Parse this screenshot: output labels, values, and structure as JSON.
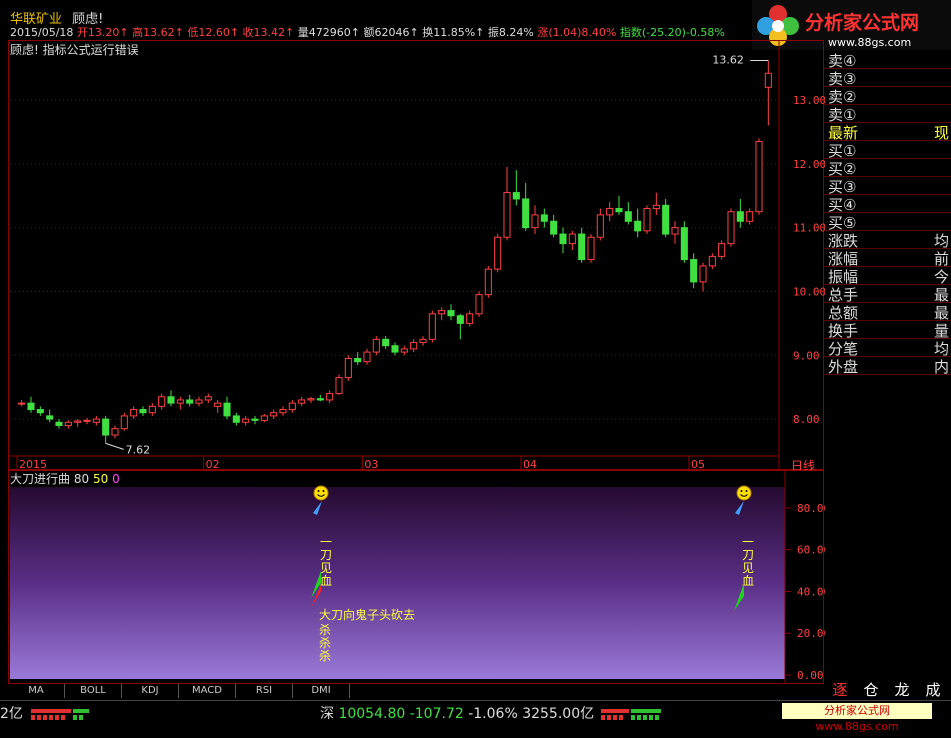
{
  "header": {
    "stock_name": "华联矿业",
    "warning": "顾虑!",
    "date": "2015/05/18",
    "quotes": [
      {
        "label": "开",
        "value": "13.20",
        "color": "red"
      },
      {
        "label": "高",
        "value": "13.62",
        "color": "red"
      },
      {
        "label": "低",
        "value": "12.60",
        "color": "red"
      },
      {
        "label": "收",
        "value": "13.42",
        "color": "red"
      },
      {
        "label": "量",
        "value": "472960",
        "color": "white"
      },
      {
        "label": "额",
        "value": "62046",
        "color": "white"
      },
      {
        "label": "换",
        "value": "11.85%",
        "color": "white"
      },
      {
        "label": "振",
        "value": "8.24%",
        "color": "white"
      },
      {
        "label": "涨",
        "value": "(1.04)8.40%",
        "color": "red"
      },
      {
        "label": "指数",
        "value": "(-25.20)-0.58%",
        "color": "green"
      }
    ],
    "error_message": "顾虑! 指标公式运行错误"
  },
  "logo": {
    "title": "分析家公式网",
    "url": "www.88gs.com"
  },
  "main_chart": {
    "price_labels": [
      "13.00",
      "12.00",
      "11.00",
      "10.00",
      "9.00",
      "8.00"
    ],
    "high_marker": "13.62",
    "low_marker": "7.62",
    "x_labels": [
      "2015",
      "02",
      "03",
      "04",
      "05"
    ],
    "period": "日线"
  },
  "right_panel": [
    {
      "label": "卖④",
      "value": ""
    },
    {
      "label": "卖③",
      "value": ""
    },
    {
      "label": "卖②",
      "value": ""
    },
    {
      "label": "卖①",
      "value": ""
    },
    {
      "label": "最新",
      "value": "现",
      "highlight": true
    },
    {
      "label": "买①",
      "value": ""
    },
    {
      "label": "买②",
      "value": ""
    },
    {
      "label": "买③",
      "value": ""
    },
    {
      "label": "买④",
      "value": ""
    },
    {
      "label": "买⑤",
      "value": ""
    },
    {
      "label": "涨跌",
      "value": "均"
    },
    {
      "label": "涨幅",
      "value": "前"
    },
    {
      "label": "振幅",
      "value": "今"
    },
    {
      "label": "总手",
      "value": "最"
    },
    {
      "label": "总额",
      "value": "最"
    },
    {
      "label": "换手",
      "value": "量"
    },
    {
      "label": "分笔",
      "value": "均"
    },
    {
      "label": "外盘",
      "value": "内"
    }
  ],
  "indicator": {
    "name": "大刀进行曲",
    "param1": "80",
    "param2": "50",
    "param3": "0",
    "y_labels": [
      "80.00",
      "60.00",
      "40.00",
      "20.00",
      "0.00"
    ],
    "signal_text_1": "一刀见血",
    "signal_text_2": "大刀向鬼子头砍去",
    "signal_text_3": "杀杀杀",
    "signal_text_4": "一刀见血"
  },
  "tabs": [
    "MA",
    "BOLL",
    "KDJ",
    "MACD",
    "RSI",
    "DMI"
  ],
  "right_buttons": [
    "逐",
    "仓",
    "龙",
    "成"
  ],
  "status": {
    "left_value": "2亿",
    "market": "深",
    "index_value": "10054.80",
    "change": "-107.72",
    "percent": "-1.06%",
    "amount": "3255.00亿",
    "footer_logo": "分析家公式网 www.88gs.com"
  },
  "colors": {
    "up": "#ff4040",
    "down": "#40e040",
    "bg": "#000000",
    "grid": "#8b0000"
  },
  "chart_data": {
    "type": "candlestick",
    "x_labels": [
      "2015",
      "02",
      "03",
      "04",
      "05"
    ],
    "ylim": [
      7.5,
      13.8
    ],
    "candles": [
      [
        8.25,
        8.3,
        8.2,
        8.25
      ],
      [
        8.25,
        8.35,
        8.1,
        8.15
      ],
      [
        8.15,
        8.2,
        8.05,
        8.1
      ],
      [
        8.05,
        8.15,
        7.95,
        8.0
      ],
      [
        7.95,
        8.0,
        7.85,
        7.9
      ],
      [
        7.9,
        7.98,
        7.85,
        7.95
      ],
      [
        7.95,
        8.0,
        7.88,
        7.97
      ],
      [
        7.97,
        8.02,
        7.92,
        7.98
      ],
      [
        7.95,
        8.05,
        7.9,
        8.0
      ],
      [
        8.0,
        8.05,
        7.62,
        7.75
      ],
      [
        7.75,
        7.9,
        7.7,
        7.85
      ],
      [
        7.85,
        8.1,
        7.82,
        8.05
      ],
      [
        8.05,
        8.2,
        8.0,
        8.15
      ],
      [
        8.15,
        8.2,
        8.05,
        8.1
      ],
      [
        8.1,
        8.25,
        8.05,
        8.2
      ],
      [
        8.2,
        8.4,
        8.15,
        8.35
      ],
      [
        8.35,
        8.45,
        8.2,
        8.25
      ],
      [
        8.25,
        8.35,
        8.15,
        8.3
      ],
      [
        8.3,
        8.38,
        8.2,
        8.25
      ],
      [
        8.25,
        8.35,
        8.2,
        8.3
      ],
      [
        8.3,
        8.4,
        8.25,
        8.35
      ],
      [
        8.2,
        8.3,
        8.1,
        8.25
      ],
      [
        8.25,
        8.35,
        8.0,
        8.05
      ],
      [
        8.05,
        8.1,
        7.9,
        7.95
      ],
      [
        7.95,
        8.05,
        7.9,
        8.0
      ],
      [
        8.0,
        8.05,
        7.92,
        7.98
      ],
      [
        7.98,
        8.08,
        7.95,
        8.05
      ],
      [
        8.05,
        8.15,
        8.0,
        8.1
      ],
      [
        8.1,
        8.2,
        8.05,
        8.15
      ],
      [
        8.15,
        8.3,
        8.1,
        8.25
      ],
      [
        8.25,
        8.35,
        8.2,
        8.3
      ],
      [
        8.3,
        8.35,
        8.25,
        8.32
      ],
      [
        8.32,
        8.38,
        8.28,
        8.3
      ],
      [
        8.3,
        8.45,
        8.25,
        8.4
      ],
      [
        8.4,
        8.7,
        8.38,
        8.65
      ],
      [
        8.65,
        9.0,
        8.6,
        8.95
      ],
      [
        8.95,
        9.05,
        8.85,
        8.9
      ],
      [
        8.9,
        9.1,
        8.85,
        9.05
      ],
      [
        9.05,
        9.3,
        9.0,
        9.25
      ],
      [
        9.25,
        9.3,
        9.1,
        9.15
      ],
      [
        9.15,
        9.2,
        9.0,
        9.05
      ],
      [
        9.05,
        9.15,
        9.0,
        9.1
      ],
      [
        9.1,
        9.25,
        9.05,
        9.2
      ],
      [
        9.2,
        9.3,
        9.15,
        9.25
      ],
      [
        9.25,
        9.7,
        9.2,
        9.65
      ],
      [
        9.65,
        9.75,
        9.55,
        9.7
      ],
      [
        9.7,
        9.8,
        9.55,
        9.62
      ],
      [
        9.62,
        9.65,
        9.25,
        9.5
      ],
      [
        9.5,
        9.7,
        9.45,
        9.65
      ],
      [
        9.65,
        10.0,
        9.6,
        9.95
      ],
      [
        9.95,
        10.4,
        9.9,
        10.35
      ],
      [
        10.35,
        10.9,
        10.3,
        10.85
      ],
      [
        10.85,
        11.95,
        10.8,
        11.55
      ],
      [
        11.55,
        11.9,
        11.35,
        11.45
      ],
      [
        11.45,
        11.7,
        10.95,
        11.0
      ],
      [
        11.0,
        11.35,
        10.9,
        11.2
      ],
      [
        11.2,
        11.3,
        11.0,
        11.1
      ],
      [
        11.1,
        11.2,
        10.85,
        10.9
      ],
      [
        10.9,
        11.0,
        10.6,
        10.75
      ],
      [
        10.75,
        10.95,
        10.65,
        10.9
      ],
      [
        10.9,
        11.0,
        10.45,
        10.5
      ],
      [
        10.5,
        10.9,
        10.45,
        10.85
      ],
      [
        10.85,
        11.3,
        10.8,
        11.2
      ],
      [
        11.2,
        11.4,
        11.1,
        11.3
      ],
      [
        11.3,
        11.5,
        11.2,
        11.25
      ],
      [
        11.25,
        11.4,
        11.05,
        11.1
      ],
      [
        11.1,
        11.3,
        10.85,
        10.95
      ],
      [
        10.95,
        11.35,
        10.9,
        11.3
      ],
      [
        11.3,
        11.55,
        11.2,
        11.35
      ],
      [
        11.35,
        11.45,
        10.85,
        10.9
      ],
      [
        10.9,
        11.1,
        10.75,
        11.0
      ],
      [
        11.0,
        11.1,
        10.45,
        10.5
      ],
      [
        10.5,
        10.6,
        10.05,
        10.15
      ],
      [
        10.15,
        10.45,
        10.0,
        10.4
      ],
      [
        10.4,
        10.6,
        10.35,
        10.55
      ],
      [
        10.55,
        10.8,
        10.5,
        10.75
      ],
      [
        10.75,
        11.3,
        10.7,
        11.25
      ],
      [
        11.25,
        11.45,
        11.0,
        11.1
      ],
      [
        11.1,
        11.3,
        11.05,
        11.25
      ],
      [
        11.25,
        12.4,
        11.2,
        12.35
      ],
      [
        13.2,
        13.62,
        12.6,
        13.42
      ]
    ]
  }
}
